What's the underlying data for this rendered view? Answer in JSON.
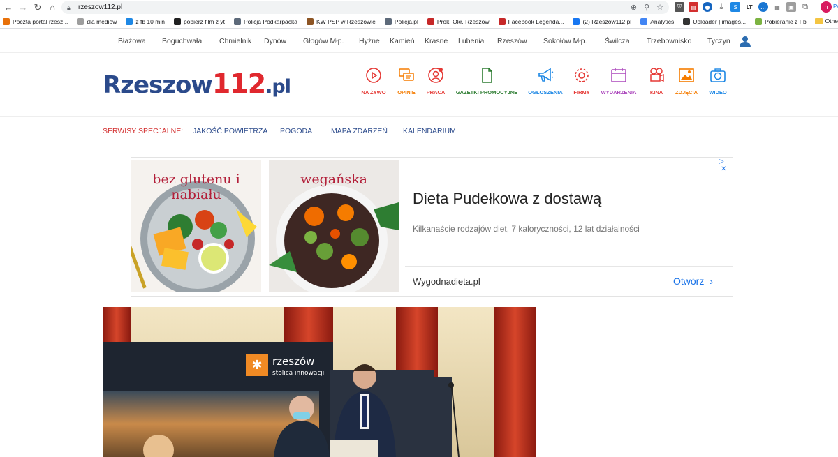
{
  "browser": {
    "url": "rzeszow112.pl",
    "bookmarks": [
      {
        "label": "Poczta portal rzesz...",
        "color": "#e8710a"
      },
      {
        "label": "dla mediów",
        "color": "#9e9e9e"
      },
      {
        "label": "z fb 10 min",
        "color": "#1e88e5"
      },
      {
        "label": "pobierz film z yt",
        "color": "#212121"
      },
      {
        "label": "Policja Podkarpacka",
        "color": "#5d6a7a"
      },
      {
        "label": "KW PSP w Rzeszowie",
        "color": "#8d5524"
      },
      {
        "label": "Policja.pl",
        "color": "#5d6a7a"
      },
      {
        "label": "Prok. Okr. Rzeszow",
        "color": "#c62828"
      },
      {
        "label": "Facebook Legenda...",
        "color": "#c62828"
      },
      {
        "label": "(2) Rzeszow112.pl",
        "color": "#1877f2"
      },
      {
        "label": "Analytics",
        "color": "#4285f4"
      },
      {
        "label": "Uploader | images...",
        "color": "#333333"
      },
      {
        "label": "Pobieranie z Fb",
        "color": "#7cb342"
      }
    ],
    "bookmarks_more": "»",
    "bookmarks_other": "Othe",
    "avatar_letter": "h",
    "profile_label": "Pa"
  },
  "regions": [
    "Błażowa",
    "Boguchwała",
    "Chmielnik",
    "Dynów",
    "Głogów Młp.",
    "Hyżne",
    "Kamień",
    "Krasne",
    "Lubenia",
    "Rzeszów",
    "Sokołów Młp.",
    "Świlcza",
    "Trzebownisko",
    "Tyczyn"
  ],
  "logo": {
    "part1": "Rzeszow",
    "part2": "112",
    "part3": ".pl"
  },
  "services": [
    {
      "label": "NA ŻYWO",
      "color": "#e53935",
      "icon": "play-icon"
    },
    {
      "label": "OPINIE",
      "color": "#f57c00",
      "icon": "chat-icon"
    },
    {
      "label": "PRACA",
      "color": "#e53935",
      "icon": "worker-icon"
    },
    {
      "label": "GAZETKI PROMOCYJNE",
      "color": "#2e7d32",
      "icon": "document-icon"
    },
    {
      "label": "OGŁOSZENIA",
      "color": "#1e88e5",
      "icon": "megaphone-icon"
    },
    {
      "label": "FIRMY",
      "color": "#e53935",
      "icon": "gear-icon"
    },
    {
      "label": "WYDARZENIA",
      "color": "#ab47bc",
      "icon": "calendar-icon"
    },
    {
      "label": "KINA",
      "color": "#e53935",
      "icon": "camera-reel-icon"
    },
    {
      "label": "ZDJĘCIA",
      "color": "#f57c00",
      "icon": "picture-icon"
    },
    {
      "label": "WIDEO",
      "color": "#1e88e5",
      "icon": "video-camera-icon"
    }
  ],
  "special": {
    "label": "SERWISY SPECJALNE:",
    "links": [
      "JAKOŚĆ POWIETRZA",
      "POGODA",
      "MAPA ZDARZEŃ",
      "KALENDARIUM"
    ]
  },
  "ad": {
    "image1_caption": "bez glutenu i nabiału",
    "image2_caption": "wegańska",
    "headline": "Dieta Pudełkowa z dostawą",
    "description": "Kilkanaście rodzajów diet, 7 kaloryczności, 12 lat działalności",
    "domain": "Wygodnadieta.pl",
    "cta": "Otwórz",
    "choices_icon": "▷",
    "close_icon": "✕"
  },
  "photo": {
    "banner_text_1": "rzeszów",
    "banner_text_2": "stolica innowacji"
  }
}
